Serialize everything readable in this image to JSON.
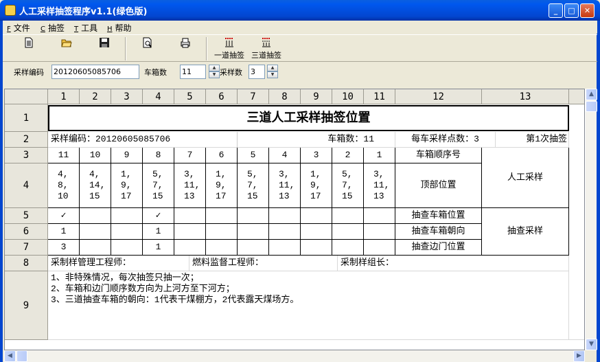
{
  "window": {
    "title": "人工采样抽签程序v1.1(绿色版)",
    "min_label": "_",
    "max_label": "□",
    "close_label": "✕"
  },
  "menu": [
    {
      "key": "F",
      "label": "文件"
    },
    {
      "key": "C",
      "label": "抽签"
    },
    {
      "key": "T",
      "label": "工具"
    },
    {
      "key": "H",
      "label": "帮助"
    }
  ],
  "toolbar": {
    "one_lane_label": "一道抽签",
    "three_lane_label": "三道抽签"
  },
  "params": {
    "code_label": "采样编码",
    "code_value": "20120605085706",
    "cars_label": "车箱数",
    "cars_value": "11",
    "samples_label": "采样数",
    "samples_value": "3"
  },
  "grid": {
    "col_headers": [
      "1",
      "2",
      "3",
      "4",
      "5",
      "6",
      "7",
      "8",
      "9",
      "10",
      "11",
      "12",
      "13"
    ],
    "row_headers": [
      "1",
      "2",
      "3",
      "4",
      "5",
      "6",
      "7",
      "8",
      "9"
    ],
    "title": "三道人工采样抽签位置",
    "info": {
      "code": "采样编码：20120605085706",
      "cars": "车箱数：11",
      "points": "每车采样点数：3",
      "round": "第1次抽签"
    },
    "car_order": [
      "11",
      "10",
      "9",
      "8",
      "7",
      "6",
      "5",
      "4",
      "3",
      "2",
      "1"
    ],
    "top_positions": [
      [
        "4,",
        "8,",
        "10"
      ],
      [
        "4,",
        "14,",
        "15"
      ],
      [
        "1,",
        "9,",
        "17"
      ],
      [
        "5,",
        "7,",
        "15"
      ],
      [
        "3,",
        "11,",
        "13"
      ],
      [
        "1,",
        "9,",
        "17"
      ],
      [
        "5,",
        "7,",
        "15"
      ],
      [
        "3,",
        "11,",
        "13"
      ],
      [
        "1,",
        "9,",
        "17"
      ],
      [
        "5,",
        "7,",
        "15"
      ],
      [
        "3,",
        "11,",
        "13"
      ]
    ],
    "row5": [
      "✓",
      "",
      "",
      "✓",
      "",
      "",
      "",
      "",
      "",
      "",
      ""
    ],
    "row6": [
      "1",
      "",
      "",
      "1",
      "",
      "",
      "",
      "",
      "",
      "",
      ""
    ],
    "row7": [
      "3",
      "",
      "",
      "1",
      "",
      "",
      "",
      "",
      "",
      "",
      ""
    ],
    "labels": {
      "car_order": "车箱顺序号",
      "top_pos": "顶部位置",
      "manual": "人工采样",
      "check_pos": "抽查车箱位置",
      "check_dir": "抽查车箱朝向",
      "check_door": "抽查边门位置",
      "check": "抽查采样"
    },
    "signatures": {
      "engineer": "采制样管理工程师：",
      "fuel": "燃料监督工程师：",
      "leader": "采制样组长："
    },
    "notes": [
      "1、非特殊情况，每次抽签只抽一次；",
      "2、车箱和边门顺序数方向为上河方至下河方；",
      "3、三道抽查车箱的朝向：1代表干煤棚方，2代表露天煤场方。"
    ]
  }
}
